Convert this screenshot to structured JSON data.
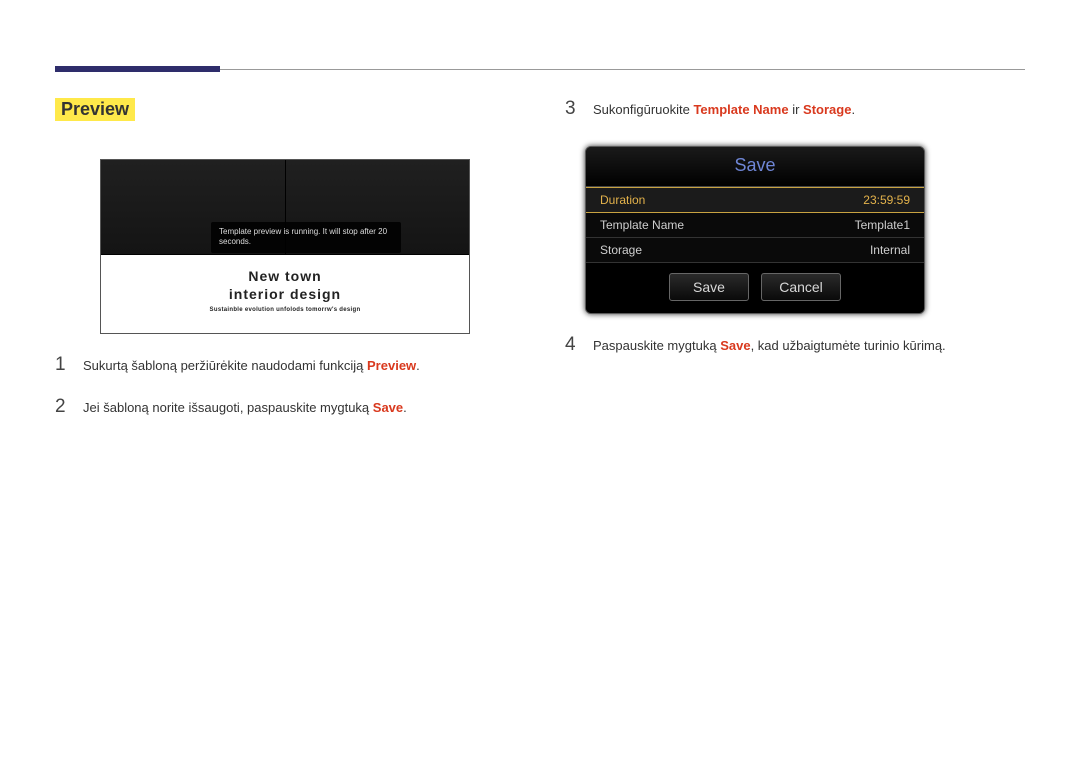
{
  "section_title": "Preview",
  "preview": {
    "tooltip": "Template preview is running. It will stop after 20 seconds.",
    "title_line1": "New town",
    "title_line2": "interior design",
    "subtitle": "Sustainble evolution unfolods tomorrw's design"
  },
  "steps_left": [
    {
      "num": "1",
      "pre": "Sukurtą šabloną peržiūrėkite naudodami funkciją ",
      "kw": "Preview",
      "post": "."
    },
    {
      "num": "2",
      "pre": "Jei šabloną norite išsaugoti, paspauskite mygtuką ",
      "kw": "Save",
      "post": "."
    }
  ],
  "step3": {
    "num": "3",
    "pre": "Sukonfigūruokite ",
    "kw1": "Template Name",
    "mid": " ir ",
    "kw2": "Storage",
    "post": "."
  },
  "dialog": {
    "title": "Save",
    "rows": [
      {
        "label": "Duration",
        "value": "23:59:59",
        "selected": true
      },
      {
        "label": "Template Name",
        "value": "Template1",
        "selected": false
      },
      {
        "label": "Storage",
        "value": "Internal",
        "selected": false
      }
    ],
    "save_btn": "Save",
    "cancel_btn": "Cancel"
  },
  "step4": {
    "num": "4",
    "pre": "Paspauskite mygtuką ",
    "kw": "Save",
    "post": ", kad užbaigtumėte turinio kūrimą."
  }
}
